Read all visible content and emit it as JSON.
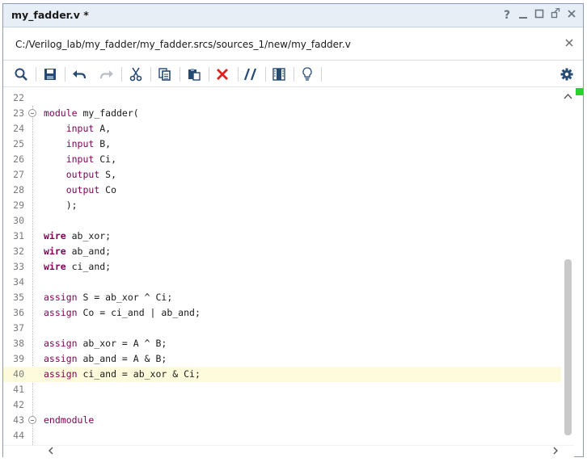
{
  "window": {
    "title": "my_fadder.v *",
    "controls": [
      "?",
      "minimize",
      "maximize",
      "restore",
      "close"
    ]
  },
  "path": {
    "text": "C:/Verilog_lab/my_fadder/my_fadder.srcs/sources_1/new/my_fadder.v",
    "close_icon": "close-icon"
  },
  "toolbar": {
    "buttons": [
      "search-icon",
      "save-icon",
      "undo-icon",
      "redo-icon",
      "cut-icon",
      "copy-icon",
      "paste-icon",
      "delete-icon",
      "comment-icon",
      "toggle-columns-icon",
      "lightbulb-icon",
      "settings-icon"
    ],
    "colors": {
      "accent_red": "#e02020",
      "icon_blue": "#264a73"
    }
  },
  "editor": {
    "highlighted_line": 40,
    "lines": [
      {
        "num": "22",
        "text": ""
      },
      {
        "num": "23",
        "text": "module my_fadder("
      },
      {
        "num": "24",
        "text": "    input A,"
      },
      {
        "num": "25",
        "text": "    input B,"
      },
      {
        "num": "26",
        "text": "    input Ci,"
      },
      {
        "num": "27",
        "text": "    output S,"
      },
      {
        "num": "28",
        "text": "    output Co"
      },
      {
        "num": "29",
        "text": "    );"
      },
      {
        "num": "30",
        "text": ""
      },
      {
        "num": "31",
        "text": "wire ab_xor;"
      },
      {
        "num": "32",
        "text": "wire ab_and;"
      },
      {
        "num": "33",
        "text": "wire ci_and;"
      },
      {
        "num": "34",
        "text": ""
      },
      {
        "num": "35",
        "text": "assign S = ab_xor ^ Ci;"
      },
      {
        "num": "36",
        "text": "assign Co = ci_and | ab_and;"
      },
      {
        "num": "37",
        "text": ""
      },
      {
        "num": "38",
        "text": "assign ab_xor = A ^ B;"
      },
      {
        "num": "39",
        "text": "assign ab_and = A & B;"
      },
      {
        "num": "40",
        "text": "assign ci_and = ab_xor & Ci;"
      },
      {
        "num": "41",
        "text": ""
      },
      {
        "num": "42",
        "text": ""
      },
      {
        "num": "43",
        "text": "endmodule"
      },
      {
        "num": "44",
        "text": ""
      }
    ]
  }
}
